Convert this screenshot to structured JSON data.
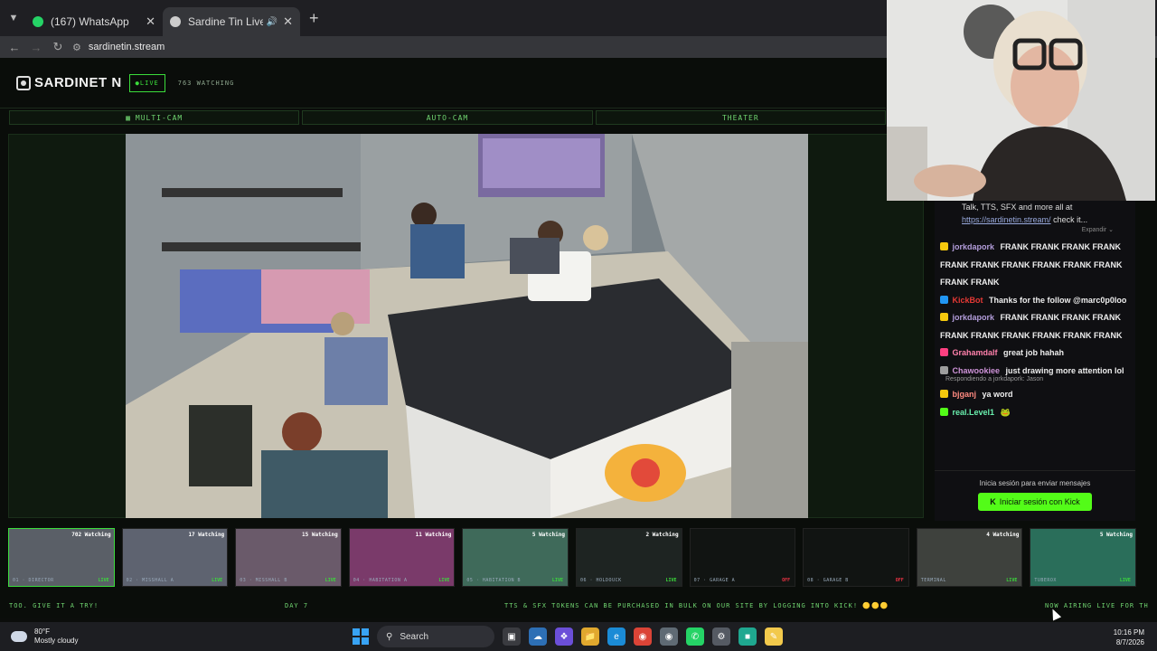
{
  "browser": {
    "tabs": [
      {
        "label": "(167) WhatsApp",
        "active": false,
        "favicon_color": "#25d366"
      },
      {
        "label": "Sardine Tin Live - All Rooms",
        "active": true,
        "favicon_color": "#cccccc"
      }
    ],
    "url": "sardinetin.stream"
  },
  "site": {
    "logo": "SARDINET N",
    "live_badge": "●LIVE",
    "watching": "763 WATCHING",
    "modes": [
      {
        "label": "MULTI-CAM",
        "icon": "grid-icon"
      },
      {
        "label": "AUTO-CAM",
        "icon": ""
      },
      {
        "label": "THEATER",
        "icon": ""
      }
    ]
  },
  "chat": {
    "pinned_text": "Talk, TTS, SFX and more all at",
    "pinned_link": "https://sardinetin.stream/",
    "pinned_suffix": "check it...",
    "expand_label": "Expandir ⌄",
    "messages": [
      {
        "user": "jorkdapork",
        "user_color": "#b39ddb",
        "badge_color": "#f6c90e",
        "text": "FRANK FRANK FRANK FRANK FRANK FRANK FRANK FRANK FRANK FRANK FRANK FRANK"
      },
      {
        "user": "KickBot",
        "user_color": "#e53935",
        "badge_color": "#2196f3",
        "text": "Thanks for the follow @marc0p0loo"
      },
      {
        "user": "jorkdapork",
        "user_color": "#b39ddb",
        "badge_color": "#f6c90e",
        "text": "FRANK FRANK FRANK FRANK FRANK FRANK FRANK FRANK FRANK FRANK"
      },
      {
        "user": "Grahamdalf",
        "user_color": "#ff80ab",
        "badge_color": "#ff4081",
        "text": "great job hahah"
      },
      {
        "user": "Chawookiee",
        "user_color": "#ce93d8",
        "badge_color": "#9e9e9e",
        "text": "just drawing more attention lol",
        "reply": "Respondiendo a jorkdapork: Jason"
      },
      {
        "user": "bjganj",
        "user_color": "#ff8a80",
        "badge_color": "#f6c90e",
        "text": "ya word"
      },
      {
        "user": "real.Level1",
        "user_color": "#69f0ae",
        "badge_color": "#53fc18",
        "text": "🐸"
      }
    ],
    "signin_hint": "Inicia sesión para enviar mensajes",
    "signin_button": "Iniciar sesión con Kick"
  },
  "thumbnails": [
    {
      "watching": "702 Watching",
      "name": "01 · DIRECTOR",
      "status": "LIVE",
      "bg": "#5a5f67"
    },
    {
      "watching": "17 Watching",
      "name": "02 · MISSHALL A",
      "status": "LIVE",
      "bg": "#5e6370"
    },
    {
      "watching": "15 Watching",
      "name": "03 · MISSHALL B",
      "status": "LIVE",
      "bg": "#6a5a6a"
    },
    {
      "watching": "11 Watching",
      "name": "04 · HABITATION A",
      "status": "LIVE",
      "bg": "#7a3a6a"
    },
    {
      "watching": "5 Watching",
      "name": "05 · HABITATION B",
      "status": "LIVE",
      "bg": "#3f6a5a"
    },
    {
      "watching": "2 Watching",
      "name": "06 · HOLDOUCK",
      "status": "LIVE",
      "bg": "#1e2422"
    },
    {
      "watching": "",
      "name": "07 · GARAGE A",
      "status": "OFF",
      "bg": "#111412"
    },
    {
      "watching": "",
      "name": "08 · GARAGE B",
      "status": "OFF",
      "bg": "#111412"
    },
    {
      "watching": "4 Watching",
      "name": "TERMINAL",
      "status": "LIVE",
      "bg": "#3e413d"
    },
    {
      "watching": "5 Watching",
      "name": "TUBEROX",
      "status": "LIVE",
      "bg": "#2a6e5a"
    }
  ],
  "ticker": {
    "left": "TOO. GIVE IT A TRY!",
    "day": "DAY 7",
    "middle": "TTS & SFX TOKENS CAN BE PURCHASED IN BULK ON OUR SITE BY LOGGING INTO KICK! 🟡🟡🟡",
    "right": "NOW AIRING LIVE FOR TH"
  },
  "taskbar": {
    "temp": "80°F",
    "condition": "Mostly cloudy",
    "search": "Search",
    "time": "10:16 PM",
    "date": "8/7/2026"
  }
}
